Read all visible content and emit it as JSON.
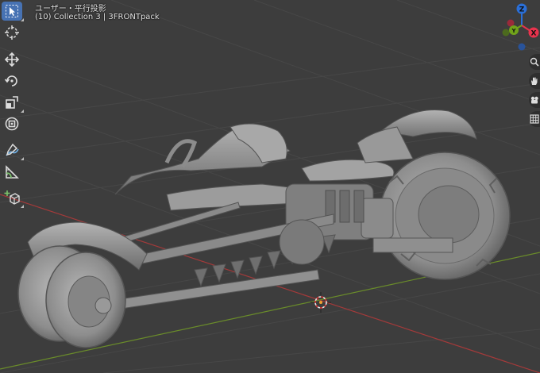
{
  "viewport": {
    "view_mode": "ユーザー・平行投影",
    "collection_info": "(10) Collection 3 | 3FRONTpack"
  },
  "gizmo": {
    "x_label": "X",
    "y_label": "Y",
    "z_label": "Z",
    "colors": {
      "x": "#e8334d",
      "y": "#71a31a",
      "z": "#2a6fd8"
    }
  },
  "toolbar": {
    "tools": [
      "select-box-tool",
      "cursor-tool",
      "move-tool",
      "rotate-tool",
      "scale-tool",
      "transform-tool",
      "annotate-tool",
      "measure-tool",
      "add-cube-tool"
    ],
    "active": "select-box-tool"
  },
  "nav_buttons": [
    "zoom-icon",
    "hand-pan-icon",
    "camera-icon",
    "grid-icon"
  ],
  "colors": {
    "background": "#3d3d3d",
    "active_tool": "#4772b3",
    "axis_x": "#a33a3a",
    "axis_y": "#6a8c2a"
  }
}
